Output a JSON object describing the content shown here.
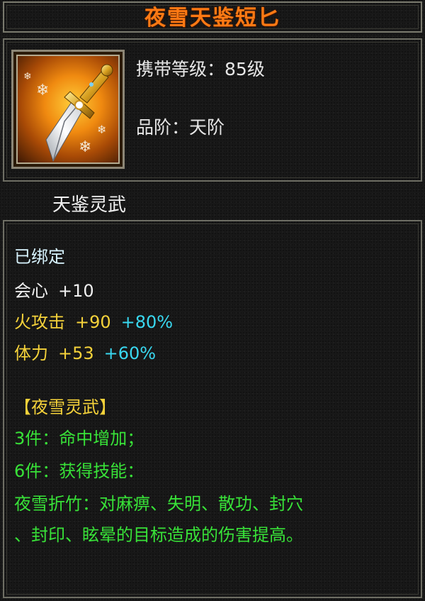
{
  "item": {
    "name": "夜雪天鉴短匕",
    "carry_level_label": "携带等级：",
    "carry_level_value": "85级",
    "grade_label": "品阶：",
    "grade_value": "天阶",
    "category": "天鉴灵武",
    "bound_status": "已绑定",
    "icon": "dagger-icon"
  },
  "stats": [
    {
      "name": "会心",
      "value": "+10",
      "bonus": ""
    },
    {
      "name": "火攻击",
      "value": "+90",
      "bonus": "+80%"
    },
    {
      "name": "体力",
      "value": "+53",
      "bonus": "+60%"
    }
  ],
  "set": {
    "name": "【夜雪灵武】",
    "bonus_3": "3件：命中增加；",
    "bonus_6": "6件：获得技能：",
    "skill_line1": "夜雪折竹：对麻痹、失明、散功、封穴",
    "skill_line2": "、封印、眩晕的目标造成的伤害提高。"
  },
  "colors": {
    "title": "#ff7a14",
    "stat_white": "#f0f0f0",
    "stat_yellow": "#f5d23a",
    "bonus_cyan": "#39d8f0",
    "set_green": "#38e238",
    "border": "#6e6e64"
  }
}
